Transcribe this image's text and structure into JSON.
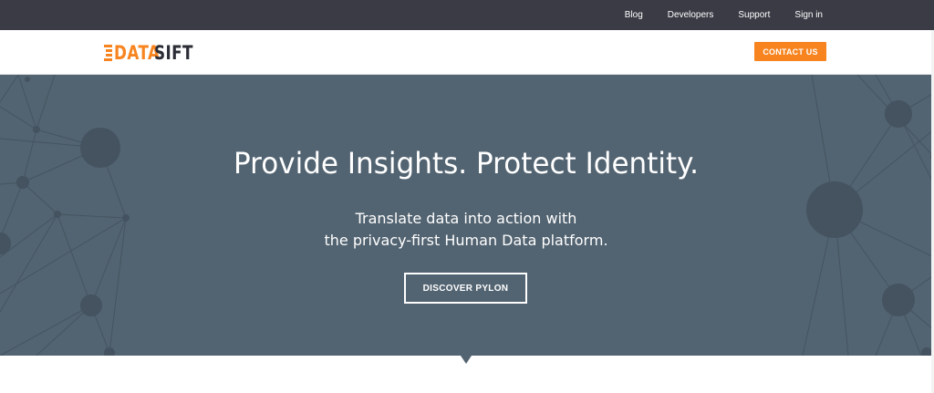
{
  "utility_nav": {
    "items": [
      {
        "label": "Blog"
      },
      {
        "label": "Developers"
      },
      {
        "label": "Support"
      },
      {
        "label": "Sign in"
      }
    ]
  },
  "header": {
    "logo": {
      "part1": "DATA",
      "part2": "SIFT"
    },
    "contact_label": "CONTACT US"
  },
  "hero": {
    "title": "Provide Insights. Protect Identity.",
    "subtitle_line1": "Translate data into action with",
    "subtitle_line2": "the privacy-first Human Data platform.",
    "cta_label": "DISCOVER PYLON"
  },
  "colors": {
    "accent": "#f7841f",
    "topbar": "#3a3b45",
    "hero_bg": "#526371",
    "logo_dark": "#2b2d36"
  }
}
